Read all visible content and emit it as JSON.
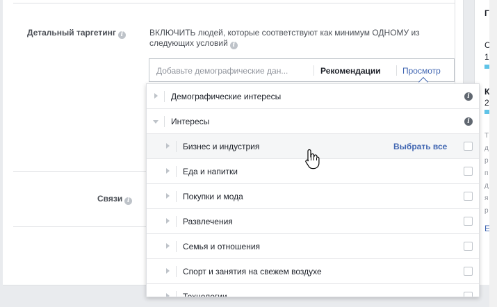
{
  "targeting": {
    "detailed_label": "Детальный таргетинг",
    "include_text": "ВКЛЮЧИТЬ людей, которые соответствуют как минимум ОДНОМУ из следующих условий",
    "search_placeholder": "Добавьте демографические дан...",
    "recommendations": "Рекомендации",
    "browse": "Просмотр"
  },
  "connections": {
    "label": "Связи"
  },
  "dropdown": {
    "categories": [
      {
        "label": "Демографические интересы",
        "expanded": false
      },
      {
        "label": "Интересы",
        "expanded": true
      }
    ],
    "subcategories": [
      {
        "label": "Бизнес и индустрия",
        "hovered": true,
        "action": "Выбрать все"
      },
      {
        "label": "Еда и напитки"
      },
      {
        "label": "Покупки и мода"
      },
      {
        "label": "Развлечения"
      },
      {
        "label": "Семья и отношения"
      },
      {
        "label": "Спорт и занятия на свежем воздухе"
      },
      {
        "label": "Технологии"
      }
    ]
  },
  "right_panel": {
    "heading": "Г",
    "lines": [
      "С",
      "1",
      "К",
      "2",
      "Т",
      "д",
      "р",
      "п",
      "д",
      "я",
      "р",
      "Е"
    ]
  },
  "colors": {
    "link": "#4267b2",
    "label": "#4b4f56",
    "border": "#dddfe2",
    "accent_bar": "#5fc3e7"
  },
  "icons": [
    "info-icon",
    "expand-arrow-icon",
    "collapse-arrow-icon",
    "checkbox-icon",
    "hand-pointer-icon"
  ]
}
